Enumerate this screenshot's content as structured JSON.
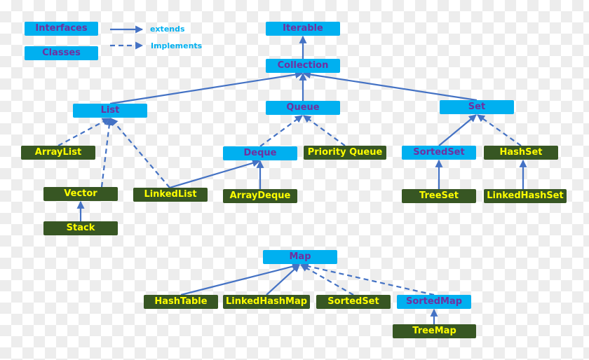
{
  "legend": {
    "interfaces": "Interfaces",
    "classes": "Classes",
    "extends": "extends",
    "implements": "Implements"
  },
  "nodes": {
    "iterable": "Iterable",
    "collection": "Collection",
    "list": "List",
    "queue": "Queue",
    "set": "Set",
    "arraylist": "ArrayList",
    "vector": "Vector",
    "stack": "Stack",
    "linkedlist": "LinkedList",
    "deque": "Deque",
    "priorityqueue": "Priority Queue",
    "arraydeque": "ArrayDeque",
    "sortedset": "SortedSet",
    "hashset": "HashSet",
    "treeset": "TreeSet",
    "linkedhashset": "LinkedHashSet",
    "map": "Map",
    "hashtable": "HashTable",
    "linkedhashmap": "LinkedHashMap",
    "sortedset_map": "SortedSet",
    "sortedmap": "SortedMap",
    "treemap": "TreeMap"
  },
  "colors": {
    "interface_fill": "#00b0f0",
    "interface_text": "#7030a0",
    "class_fill": "#375623",
    "class_text": "#ffff00",
    "edge": "#4472c4",
    "legend_text": "#00b0f0"
  }
}
